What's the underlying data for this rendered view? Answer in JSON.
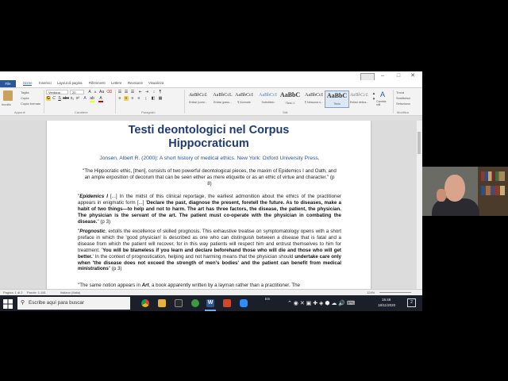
{
  "word": {
    "title_center": "",
    "tabs": [
      "File",
      "Home",
      "Inserisci",
      "Layout di pagina",
      "Riferimenti",
      "Lettere",
      "Revisione",
      "Visualizza"
    ],
    "active_tab": "Home",
    "clipboard": {
      "paste": "Incolla",
      "cut": "Taglia",
      "copy": "Copia",
      "format_painter": "Copia formato",
      "group": "Appunti"
    },
    "font": {
      "name": "Verdana",
      "size": "20",
      "group": "Carattere"
    },
    "paragraph_group": "Paragrafo",
    "styles_group": "Stili",
    "styles": [
      {
        "sample": "AaBbCcL",
        "name": "Enfasi (corsi..."
      },
      {
        "sample": "AaBbCcL",
        "name": "Enfasi grass..."
      },
      {
        "sample": "AaBbCcI",
        "name": "¶ Normale"
      },
      {
        "sample": "AaBbCcI",
        "name": "Sottotitolo"
      },
      {
        "sample": "AaBbC",
        "name": "Titolo 1"
      },
      {
        "sample": "AaBbCcI",
        "name": "¶ Nessuna s..."
      },
      {
        "sample": "AaBbC",
        "name": "Titolo"
      },
      {
        "sample": "AaBbCcL",
        "name": "Enfasi delica..."
      }
    ],
    "change_styles": "Cambia stili",
    "editing": {
      "find": "Trova",
      "replace": "Sostituisci",
      "select": "Seleziona",
      "group": "Modifica"
    },
    "status": {
      "page": "Pagina: 1 di 2",
      "words": "Parole: 1.181",
      "lang": "Italiano (Italia)",
      "zoom": "124%"
    }
  },
  "document": {
    "title_line1": "Testi deontologici nel Corpus",
    "title_line2": "Hippocraticum",
    "citation": "Jonsen, Albert R. (2000): A short history of medical ethics. New York: Oxford University Press.",
    "p1": "\"The Hippocratic ethic, [then], consists of two powerful deontological pieces, the maxim of Epidemics I and Oath, and an ample exposition of decorum that can be seen either as mere etiquette or as an ethic of virtue and character.\" (p 8)",
    "p2_html": "\"<b><i>Epidemics I</i></b> [...] In the midst of this clinical reportage, the earliest admonition about the ethics of the practitioner appears in enigmatic form [...] '<b>Declare the past, diagnose the present, foretell the future. As to diseases, make a habit of two things—to help and not to harm. The art has three factors, the disease, the patient, the physician. The physician is the servant of the art. The patient must co-operate with the physician in combating the disease.</b>\" (p 3)",
    "p3_html": "\"<b><i>Prognostic</i></b>, extolls the excellence of skilled prognosis. This exhaustive treatise on symptomatology opens with a short preface in which the 'good physician' is described as one who can distinguish between a disease that is fatal and a disease from which the patient will recover, for in this way patients will respect him and entrust themselves to him for treatment. '<b>You will be blameless if you learn and declare beforehand those who will die and those who will get better.</b>' In the context of prognostication, helping and not harming means that the physician should <b>undertake care only when 'the disease does not exceed the strength of men's bodies' and the patient can benefit from medical ministrations</b>\" (p 3)",
    "p4_html": "\"The same notion appears in <b><i>Art</i></b>, a book apparently written by a layman rather than a practitioner. The"
  },
  "taskbar": {
    "search_placeholder": "Escribe aquí para buscar",
    "lang": "ES",
    "time": "15:48",
    "date": "18/11/2020",
    "notifications": "2"
  },
  "colors": {
    "word_blue": "#2b579a",
    "title_navy": "#1f3b73",
    "taskbar": "#1b1f2a"
  }
}
